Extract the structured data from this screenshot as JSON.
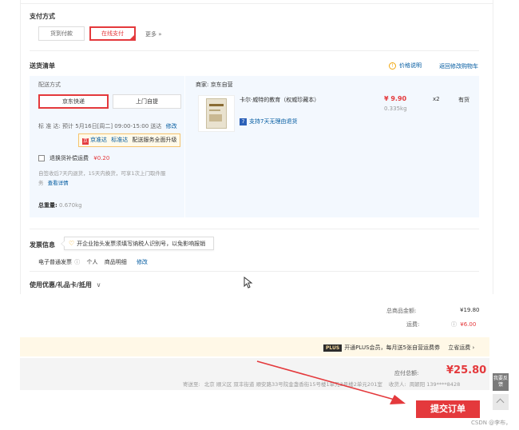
{
  "payment": {
    "title": "支付方式",
    "options": [
      "货到付款",
      "在线支付"
    ],
    "more": "更多 »"
  },
  "shipping_list": {
    "title": "送货清单",
    "price_info": "价格说明",
    "back_to_cart": "返回修改购物车",
    "method_label": "配送方式",
    "methods": [
      "京东快递",
      "上门自提"
    ],
    "standard": "标  准  达:  预计 5月16日[周二] 09:00-15:00 送达",
    "modify": "修改",
    "upgrade_brand": "京准达",
    "upgrade_standard": "标准达",
    "upgrade_text": "配送服务全面升级",
    "upgrade_icon": "京",
    "insurance_label": "退换货补偿运费",
    "insurance_price": "¥0.20",
    "insurance_desc_1": "自签收后7天内退货，15天内换货，可享1次上门取件服",
    "insurance_desc_2": "务",
    "view_details": "查看详情",
    "total_weight_label": "总重量:",
    "total_weight": "0.670kg",
    "merchant_label": "商家: 京东自营",
    "product": {
      "name": "卡尔·威特的教育（权威珍藏本）",
      "price": "¥ 9.90",
      "weight": "0.335kg",
      "qty": "x2",
      "stock": "有货",
      "return_badge": "7",
      "return_text": "支持7天无理由退货"
    }
  },
  "invoice": {
    "title": "发票信息",
    "tip": "开企业抬头发票须填写纳税人识别号，以免影响报销",
    "type": "电子普通发票",
    "type_icon": "ⓘ",
    "personal": "个人",
    "detail": "商品明细",
    "modify": "修改"
  },
  "coupons": {
    "title": "使用优惠/礼品卡/抵用",
    "chevron": "∨"
  },
  "summary": {
    "goods_total_label": "总商品金额:",
    "goods_total": "¥19.80",
    "shipping_label": "运费:",
    "shipping_info_icon": "ⓘ",
    "shipping": "¥6.00"
  },
  "plus": {
    "tag": "PLUS",
    "text": "开通PLUS会员，每月送5张自营运费券",
    "action": "立省运费 ›"
  },
  "payable": {
    "label": "应付总额:",
    "amount": "¥25.80",
    "address_label": "寄送至:",
    "address": "北京 顺义区 双丰街道 顺安路33号院金盏香街15号楼1单元3号楼2单元201室",
    "receiver_label": "收货人:",
    "receiver": "周颖阳 139****8428"
  },
  "submit": {
    "label": "提交订单"
  },
  "sidebar": {
    "feedback": "我要反馈"
  },
  "watermark": "CSDN @李布，",
  "colors": {
    "accent": "#e4393c",
    "link": "#005aa0",
    "warning": "#f1a70e"
  }
}
